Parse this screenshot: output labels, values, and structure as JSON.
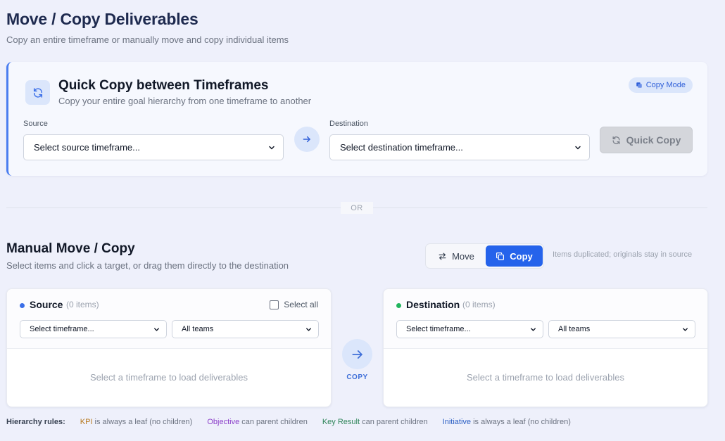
{
  "header": {
    "title": "Move / Copy Deliverables",
    "subtitle": "Copy an entire timeframe or manually move and copy individual items"
  },
  "quick_copy": {
    "title": "Quick Copy between Timeframes",
    "description": "Copy your entire goal hierarchy from one timeframe to another",
    "mode_badge": "Copy Mode",
    "source_label": "Source",
    "source_value": "Select source timeframe...",
    "destination_label": "Destination",
    "destination_value": "Select destination timeframe...",
    "button_label": "Quick Copy"
  },
  "divider": {
    "label": "OR"
  },
  "manual": {
    "title": "Manual Move / Copy",
    "description": "Select items and click a target, or drag them directly to the destination",
    "toggle": {
      "move_label": "Move",
      "copy_label": "Copy",
      "selected": "Copy"
    },
    "mode_hint": "Items duplicated; originals stay in source",
    "source_panel": {
      "title": "Source",
      "count": "(0 items)",
      "select_all_label": "Select all",
      "timeframe_value": "Select timeframe...",
      "team_value": "All teams",
      "empty_message": "Select a timeframe to load deliverables",
      "dot_color": "#3b6fe8"
    },
    "destination_panel": {
      "title": "Destination",
      "count": "(0 items)",
      "timeframe_value": "Select timeframe...",
      "team_value": "All teams",
      "empty_message": "Select a timeframe to load deliverables",
      "dot_color": "#22b55e"
    },
    "action_label": "COPY"
  },
  "hierarchy_rules": {
    "heading": "Hierarchy rules:",
    "rules": [
      {
        "type": "KPI",
        "text": " is always a leaf (no children)",
        "color": "#b7791f"
      },
      {
        "type": "Objective",
        "text": " can parent children",
        "color": "#8b3fc9"
      },
      {
        "type": "Key Result",
        "text": " can parent children",
        "color": "#2f855a"
      },
      {
        "type": "Initiative",
        "text": " is always a leaf (no children)",
        "color": "#2b5fc4"
      }
    ]
  },
  "icons": {
    "quick_copy": "refresh-icon",
    "mode_badge": "copy-icon",
    "arrow": "arrow-right-icon",
    "move": "swap-icon",
    "copy": "copy-icon",
    "select": "chevron-down-icon"
  },
  "colors": {
    "accent": "#2563eb",
    "background": "#eef0fb",
    "badge_bg": "#dbe6fb"
  }
}
